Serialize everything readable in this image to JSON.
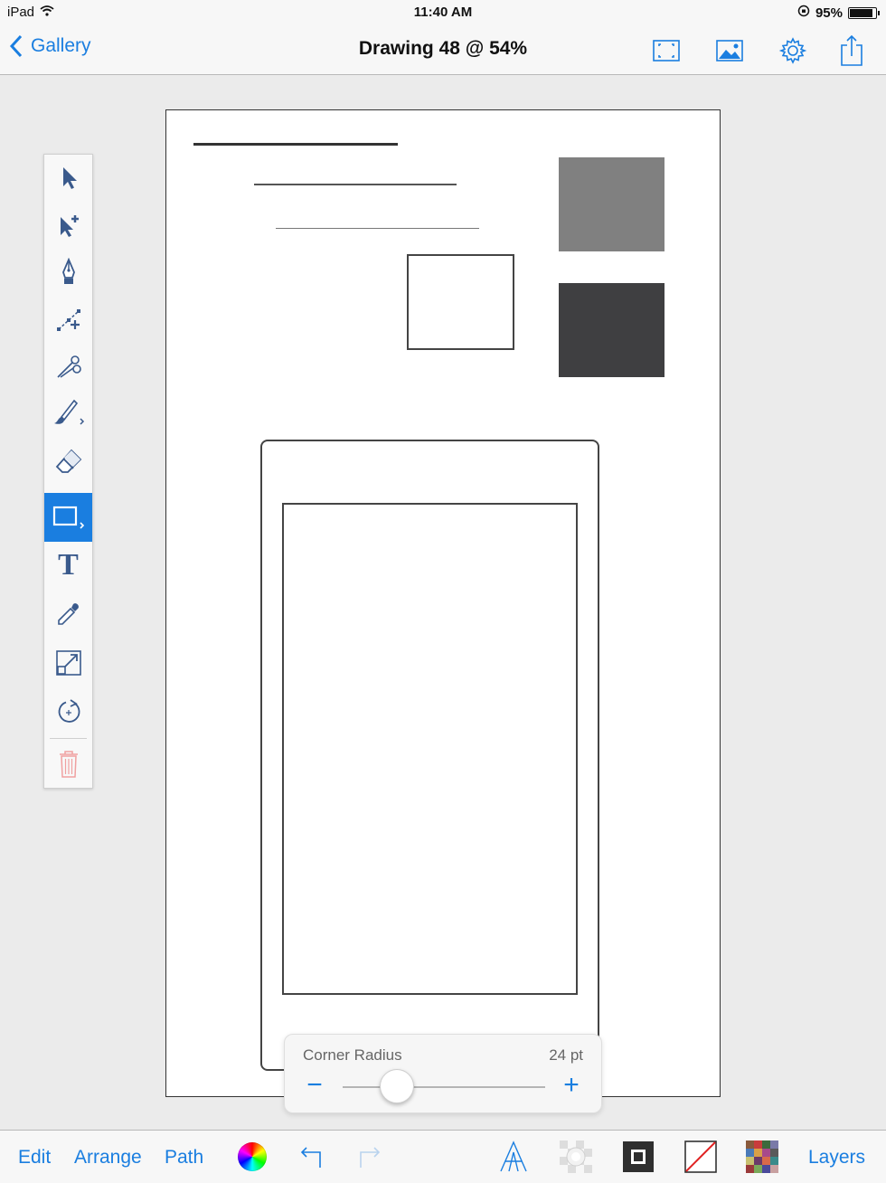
{
  "status_bar": {
    "device": "iPad",
    "time": "11:40 AM",
    "battery": "95%",
    "battery_level": 0.95
  },
  "nav": {
    "back_label": "Gallery",
    "title": "Drawing 48 @ 54%",
    "buttons": [
      "fullscreen-icon",
      "image-icon",
      "gear-icon",
      "share-icon"
    ]
  },
  "tools": [
    {
      "name": "select-arrow-icon",
      "selected": false
    },
    {
      "name": "multi-select-arrow-icon",
      "selected": false
    },
    {
      "name": "pen-nib-icon",
      "selected": false
    },
    {
      "name": "add-node-icon",
      "selected": false
    },
    {
      "name": "scissors-icon",
      "selected": false
    },
    {
      "name": "brush-icon",
      "selected": false
    },
    {
      "name": "eraser-icon",
      "selected": false
    },
    {
      "name": "rectangle-tool-icon",
      "selected": true
    },
    {
      "name": "text-tool-icon",
      "selected": false,
      "glyph": "T"
    },
    {
      "name": "eyedropper-icon",
      "selected": false
    },
    {
      "name": "scale-icon",
      "selected": false
    },
    {
      "name": "rotate-icon",
      "selected": false
    },
    {
      "name": "trash-icon",
      "selected": false
    }
  ],
  "canvas_shapes": {
    "gray_fill": "#808080",
    "dark_fill": "#3f3f41",
    "stroke": "#444444"
  },
  "corner_radius_popover": {
    "label": "Corner Radius",
    "value": "24 pt",
    "minus": "−",
    "plus": "+",
    "slider_fraction": 0.27
  },
  "bottom_bar": {
    "edit": "Edit",
    "arrange": "Arrange",
    "path": "Path",
    "layers": "Layers",
    "icons": [
      "color-wheel-icon",
      "undo-icon",
      "redo-icon",
      "font-icon",
      "shadow-icon",
      "stroke-color-icon",
      "no-fill-icon",
      "pattern-icon"
    ]
  },
  "accent_color": "#1a7ee0"
}
